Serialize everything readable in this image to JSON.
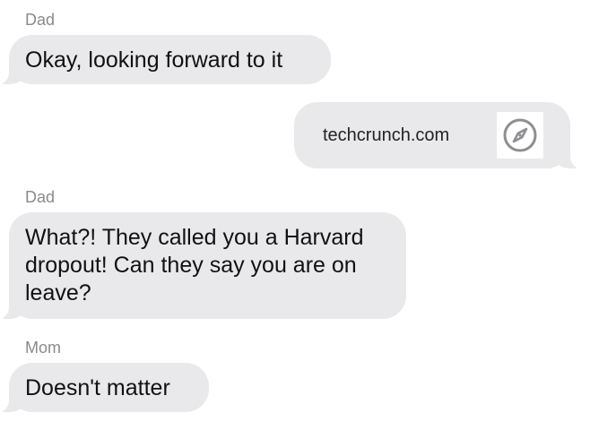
{
  "messages": [
    {
      "sender": "Dad",
      "text": "Okay, looking forward to it"
    },
    {
      "link": {
        "domain": "techcrunch.com",
        "icon": "compass-icon"
      }
    },
    {
      "sender": "Dad",
      "lines": [
        "What?! They called you a Harvard",
        "dropout! Can they say you are on",
        "leave?"
      ]
    },
    {
      "sender": "Mom",
      "text": "Doesn't matter"
    }
  ],
  "colors": {
    "bubble_background": "#e9e9eb",
    "sender_label": "#8a8a8e",
    "text": "#111111",
    "icon": "#8e8e93"
  }
}
